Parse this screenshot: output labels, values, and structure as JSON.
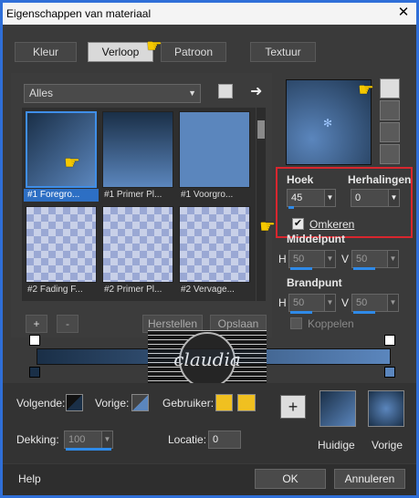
{
  "window": {
    "title": "Eigenschappen van materiaal",
    "close_glyph": "✕"
  },
  "tabs": [
    {
      "label": "Kleur",
      "active": false
    },
    {
      "label": "Verloop",
      "active": true
    },
    {
      "label": "Patroon",
      "active": false
    },
    {
      "label": "Textuur",
      "active": false
    }
  ],
  "library": {
    "dropdown_value": "Alles",
    "thumbnails": [
      {
        "caption": "#1 Foregro...",
        "selected": true
      },
      {
        "caption": "#1 Primer Pl...",
        "selected": false
      },
      {
        "caption": "#1 Voorgro...",
        "selected": false
      },
      {
        "caption": "#2 Fading F...",
        "selected": false
      },
      {
        "caption": "#2 Primer Pl...",
        "selected": false
      },
      {
        "caption": "#2 Vervage...",
        "selected": false
      }
    ],
    "add_label": "+",
    "remove_label": "-",
    "reset_label": "Herstellen",
    "save_label": "Opslaan"
  },
  "settings": {
    "hoek_label": "Hoek",
    "hoek_value": "45",
    "herhalingen_label": "Herhalingen",
    "herhalingen_value": "0",
    "omkeren_label": "Omkeren",
    "omkeren_checked": true,
    "middelpunt_label": "Middelpunt",
    "middelpunt_h_label": "H",
    "middelpunt_h_value": "50",
    "middelpunt_v_label": "V",
    "middelpunt_v_value": "50",
    "brandpunt_label": "Brandpunt",
    "brandpunt_h_label": "H",
    "brandpunt_h_value": "50",
    "brandpunt_v_label": "V",
    "brandpunt_v_value": "50",
    "koppelen_label": "Koppelen",
    "koppelen_checked": false
  },
  "bottom": {
    "volgende_label": "Volgende:",
    "vorige_label": "Vorige:",
    "gebruiker_label": "Gebruiker:",
    "dekking_label": "Dekking:",
    "dekking_value": "100",
    "locatie_label": "Locatie:",
    "locatie_value": "0",
    "huidige_label": "Huidige",
    "vorige_preview_label": "Vorige",
    "add_swatch_label": "+"
  },
  "watermark": {
    "text": "claudia"
  },
  "footer": {
    "help_label": "Help",
    "ok_label": "OK",
    "cancel_label": "Annuleren"
  },
  "colors": {
    "gradient_dark": "#1a2f47",
    "gradient_light": "#5b86bd",
    "selection_blue": "#2f6fd8",
    "highlight_red": "#d8262e",
    "user_yellow": "#f0c020"
  }
}
